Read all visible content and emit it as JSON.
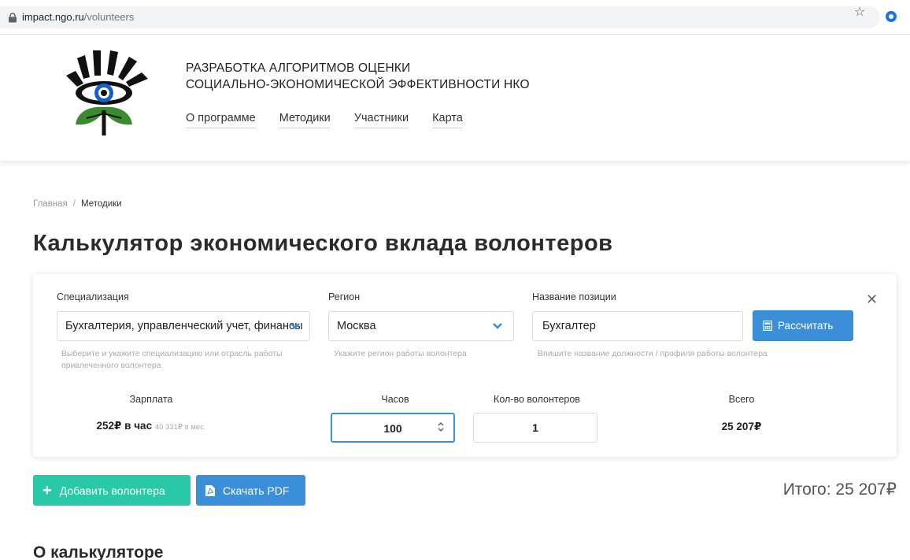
{
  "browser": {
    "url_host": "impact.ngo.ru",
    "url_path": "/volunteers"
  },
  "header": {
    "title_line1": "РАЗРАБОТКА АЛГОРИТМОВ ОЦЕНКИ",
    "title_line2": "СОЦИАЛЬНО-ЭКОНОМИЧЕСКОЙ ЭФФЕКТИВНОСТИ НКО",
    "nav": [
      {
        "label": "О программе"
      },
      {
        "label": "Методики"
      },
      {
        "label": "Участники"
      },
      {
        "label": "Карта"
      }
    ]
  },
  "breadcrumb": {
    "home": "Главная",
    "separator": "/",
    "current": "Методики"
  },
  "page_title": "Калькулятор экономического вклада волонтеров",
  "calculator": {
    "specialization": {
      "label": "Специализация",
      "value": "Бухгалтерия, управленческий учет, финансы",
      "hint": "Выберите и укажите специализацию или отрасль работы привлеченного волонтера"
    },
    "region": {
      "label": "Регион",
      "value": "Москва",
      "hint": "Укажите регион работы волонтера"
    },
    "position": {
      "label": "Название позиции",
      "value": "Бухгалтер",
      "hint": "Впишите название должности / профиля работы волонтера"
    },
    "calculate_label": "Рассчитать",
    "salary": {
      "label": "Зарплата",
      "hourly": "252₽ в час",
      "monthly": "40 331₽ в мес."
    },
    "hours": {
      "label": "Часов",
      "value": "100"
    },
    "volunteers": {
      "label": "Кол-во волонтеров",
      "value": "1"
    },
    "total": {
      "label": "Всего",
      "value": "25 207₽"
    }
  },
  "actions": {
    "add_label": "Добавить волонтера",
    "pdf_label": "Скачать PDF",
    "grand_total": "Итого: 25 207₽"
  },
  "about_title": "О калькуляторе",
  "colors": {
    "accent_blue": "#3b8fd9",
    "accent_green": "#28c8a8",
    "logo_green": "#3a8a2e",
    "logo_blue": "#1a5fc8"
  }
}
